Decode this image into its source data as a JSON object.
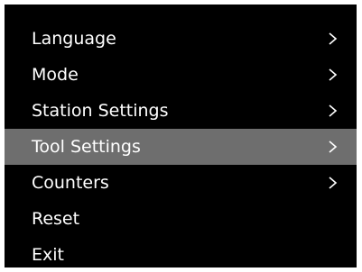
{
  "colors": {
    "screen_background": "#000000",
    "text": "#ffffff",
    "selected_row": "#6e6e6e"
  },
  "menu": {
    "items": [
      {
        "label": "Language",
        "has_submenu": true,
        "selected": false,
        "icon": "chevron-right-icon"
      },
      {
        "label": "Mode",
        "has_submenu": true,
        "selected": false,
        "icon": "chevron-right-icon"
      },
      {
        "label": "Station Settings",
        "has_submenu": true,
        "selected": false,
        "icon": "chevron-right-icon"
      },
      {
        "label": "Tool Settings",
        "has_submenu": true,
        "selected": true,
        "icon": "chevron-right-icon"
      },
      {
        "label": "Counters",
        "has_submenu": true,
        "selected": false,
        "icon": "chevron-right-icon"
      },
      {
        "label": "Reset",
        "has_submenu": false,
        "selected": false
      },
      {
        "label": "Exit",
        "has_submenu": false,
        "selected": false
      }
    ]
  }
}
